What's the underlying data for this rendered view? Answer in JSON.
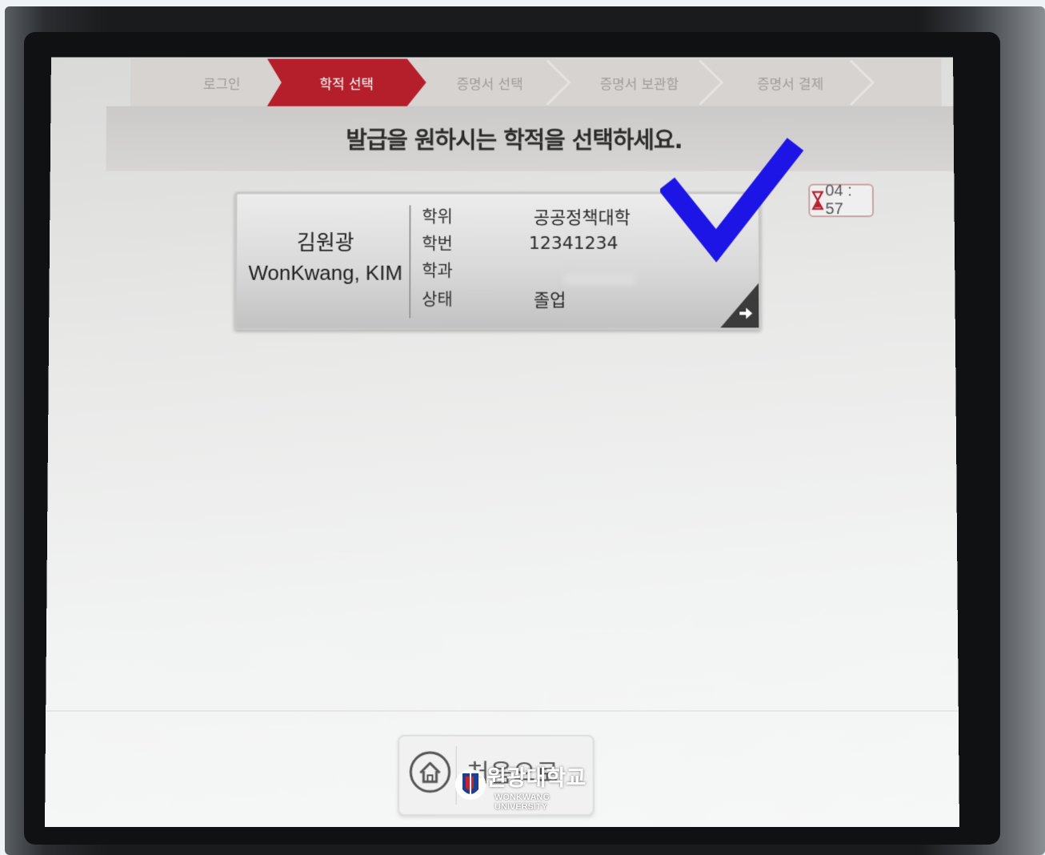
{
  "steps": [
    {
      "label": "로그인",
      "active": false
    },
    {
      "label": "학적 선택",
      "active": true
    },
    {
      "label": "증명서 선택",
      "active": false
    },
    {
      "label": "증명서 보관함",
      "active": false
    },
    {
      "label": "증명서 결제",
      "active": false
    }
  ],
  "header": {
    "title": "발급을 원하시는 학적을 선택하세요."
  },
  "record": {
    "name_ko": "김원광",
    "name_en": "WonKwang, KIM",
    "fields": [
      {
        "label": "학위",
        "value": "공공정책대학"
      },
      {
        "label": "학번",
        "value": "12341234"
      },
      {
        "label": "학과",
        "value": ""
      },
      {
        "label": "상태",
        "value": "졸업"
      }
    ]
  },
  "timer": {
    "text": "04 : 57"
  },
  "footer": {
    "home_label": "처음으로"
  },
  "watermark": {
    "name": "원광대학교",
    "sub": "WONKWANG UNIVERSITY"
  },
  "colors": {
    "accent": "#b51f2b",
    "check": "#1d14e6",
    "corner": "#3b3b3b"
  },
  "icons": {
    "home": "home-icon",
    "timer": "hourglass-icon",
    "next": "arrow-right-icon",
    "check": "checkmark-icon"
  }
}
